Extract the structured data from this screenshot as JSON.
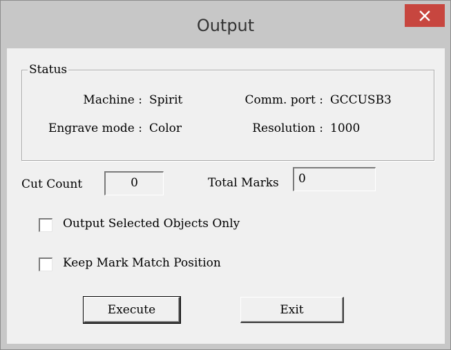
{
  "window": {
    "title": "Output",
    "close_symbol": "✕"
  },
  "status": {
    "legend": "Status",
    "machine_label": "Machine :",
    "machine_value": "Spirit",
    "comm_port_label": "Comm. port :",
    "comm_port_value": "GCCUSB3",
    "engrave_mode_label": "Engrave mode :",
    "engrave_mode_value": "Color",
    "resolution_label": "Resolution :",
    "resolution_value": "1000"
  },
  "counts": {
    "cut_count_label": "Cut Count",
    "cut_count_value": "0",
    "total_marks_label": "Total Marks",
    "total_marks_value": "0"
  },
  "options": {
    "output_selected_label": "Output Selected Objects Only",
    "output_selected_checked": false,
    "keep_mark_label": "Keep Mark Match Position",
    "keep_mark_checked": false
  },
  "buttons": {
    "execute": "Execute",
    "exit": "Exit"
  },
  "colors": {
    "close_button": "#c7463f",
    "frame": "#c7c7c7",
    "client": "#f0f0f0"
  }
}
